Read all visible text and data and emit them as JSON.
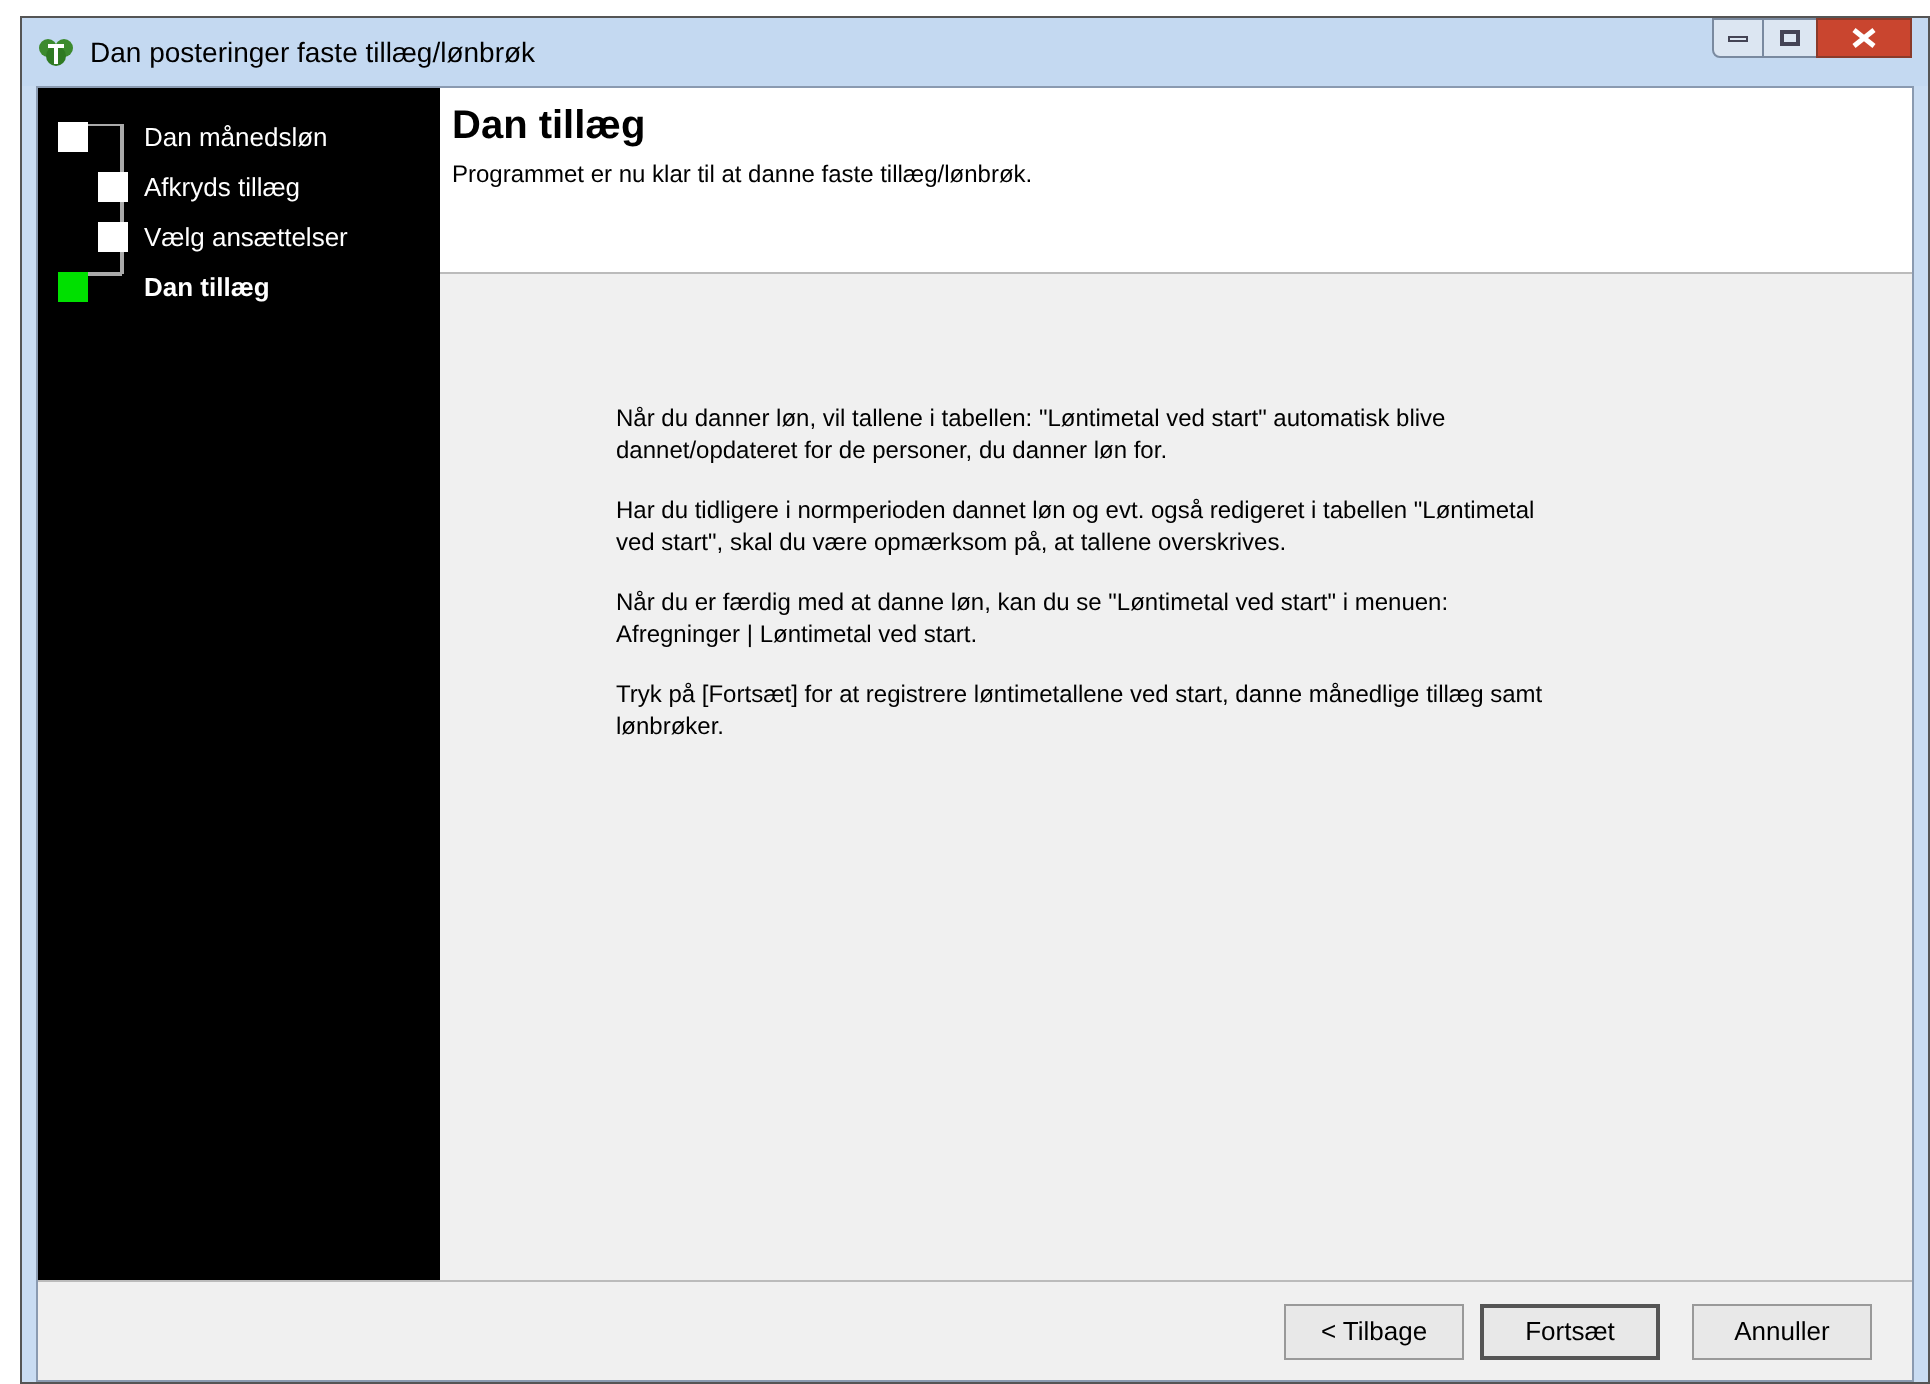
{
  "window": {
    "title": "Dan posteringer faste tillæg/lønbrøk"
  },
  "steps": [
    {
      "label": "Dan månedsløn",
      "kind": "main",
      "selected": false
    },
    {
      "label": "Afkryds tillæg",
      "kind": "sub",
      "selected": false
    },
    {
      "label": "Vælg ansættelser",
      "kind": "sub",
      "selected": false
    },
    {
      "label": "Dan tillæg",
      "kind": "main",
      "selected": true
    }
  ],
  "header": {
    "title": "Dan tillæg",
    "subtitle": "Programmet er nu klar til at danne faste tillæg/lønbrøk."
  },
  "paragraphs": [
    "Når du danner løn, vil tallene i tabellen: \"Løntimetal ved start\" automatisk blive dannet/opdateret for de personer, du danner løn for.",
    "Har du tidligere i normperioden dannet løn og evt. også redigeret i tabellen \"Løntimetal ved start\", skal du være opmærksom på, at tallene overskrives.",
    "Når du er færdig med at danne løn, kan du se \"Løntimetal ved start\" i menuen: Afregninger | Løntimetal ved start.",
    "Tryk på [Fortsæt] for at registrere løntimetallene ved start, danne månedlige tillæg samt lønbrøker."
  ],
  "buttons": [
    {
      "label": "< Tilbage",
      "selected": false
    },
    {
      "label": "Fortsæt",
      "selected": true
    },
    {
      "label": "Annuller",
      "selected": false
    }
  ]
}
